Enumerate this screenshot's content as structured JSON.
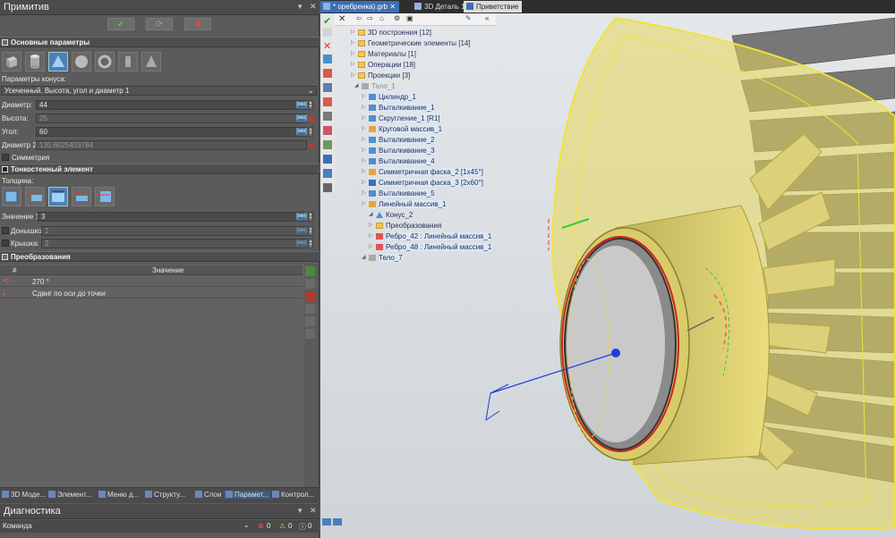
{
  "left_panel": {
    "title": "Примитив",
    "sections": {
      "main": "Основные параметры",
      "thin": "Тонкостенный элемент",
      "transforms": "Преобразования"
    },
    "cone_params_label": "Параметры конуса:",
    "cone_mode": "Усеченный. Высота, угол и диаметр 1",
    "fields": [
      {
        "label": "Диаметр:",
        "value": "44",
        "disabled": false
      },
      {
        "label": "Высота:",
        "value": "25",
        "disabled": true
      },
      {
        "label": "Угол:",
        "value": "60",
        "disabled": false
      },
      {
        "label": "Диаметр 2:",
        "value": "130.6025403784",
        "disabled": true
      }
    ],
    "symmetry_label": "Симметрия",
    "thickness_label": "Толщина:",
    "thin_fields": [
      {
        "label": "Значение 1:",
        "value": "3"
      },
      {
        "label": "Донышко:",
        "value": "2"
      },
      {
        "label": "Крышка:",
        "value": "2"
      }
    ],
    "unit": "[мм]",
    "table": {
      "headers": [
        "#",
        "Значение"
      ],
      "rows": [
        {
          "value": "270 °"
        },
        {
          "value": "Сдвиг по оси до точки"
        }
      ]
    },
    "tabs": [
      "3D Моде...",
      "Элемент...",
      "Меню д...",
      "Структу...",
      "Слои",
      "Парамет...",
      "Контрол..."
    ],
    "active_tab": "Парамет...",
    "diagnostics": {
      "title": "Диагностика",
      "column": "Команда",
      "errors": "0",
      "warnings": "0",
      "infos": "0"
    }
  },
  "document_tabs": [
    "* оребренка).grb",
    "3D Деталь 1",
    "Приветствие"
  ],
  "tree": [
    {
      "label": "3D построения [12]",
      "icon": "folder-icon",
      "depth": 0
    },
    {
      "label": "Геометрические элементы [14]",
      "icon": "folder-icon",
      "depth": 0
    },
    {
      "label": "Материалы [1]",
      "icon": "folder-icon",
      "depth": 0
    },
    {
      "label": "Операции [18]",
      "icon": "folder-icon",
      "depth": 0
    },
    {
      "label": "Проекции [3]",
      "icon": "folder-icon",
      "depth": 0
    },
    {
      "label": "Тело_1",
      "icon": "body-icon",
      "depth": 0
    },
    {
      "label": "Цилиндр_1",
      "icon": "cylinder-icon",
      "depth": 1,
      "hl": true
    },
    {
      "label": "Выталкивание_1",
      "icon": "extrude-icon",
      "depth": 1,
      "hl": true
    },
    {
      "label": "Скругление_1 [R1]",
      "icon": "fillet-icon",
      "depth": 1,
      "hl": true
    },
    {
      "label": "Круговой массив_1",
      "icon": "pattern-icon",
      "depth": 1,
      "hl": true
    },
    {
      "label": "Выталкивание_2",
      "icon": "extrude-icon",
      "depth": 1,
      "hl": true
    },
    {
      "label": "Выталкивание_3",
      "icon": "extrude-icon",
      "depth": 1,
      "hl": true
    },
    {
      "label": "Выталкивание_4",
      "icon": "extrude-icon",
      "depth": 1,
      "hl": true
    },
    {
      "label": "Симметричная фаска_2 [1x45°]",
      "icon": "chamfer-icon",
      "depth": 1,
      "hl": true
    },
    {
      "label": "Симметричная фаска_3 [2x60°]",
      "icon": "chamfer-icon",
      "depth": 1,
      "hl": true
    },
    {
      "label": "Выталкивание_5",
      "icon": "extrude-icon",
      "depth": 1,
      "hl": true
    },
    {
      "label": "Линейный массив_1",
      "icon": "pattern-icon",
      "depth": 1,
      "hl": true
    },
    {
      "label": "Конус_2",
      "icon": "cone-icon",
      "depth": 1
    },
    {
      "label": "Преобразования",
      "icon": "folder-icon",
      "depth": 2
    },
    {
      "label": "Ребро_42 : Линейный массив_1",
      "icon": "edge-icon",
      "depth": 2,
      "hl": true
    },
    {
      "label": "Ребро_48 : Линейный массив_1",
      "icon": "edge-icon",
      "depth": 2,
      "hl": true
    },
    {
      "label": "Тело_7",
      "icon": "body-icon",
      "depth": 0,
      "hl": true
    }
  ]
}
